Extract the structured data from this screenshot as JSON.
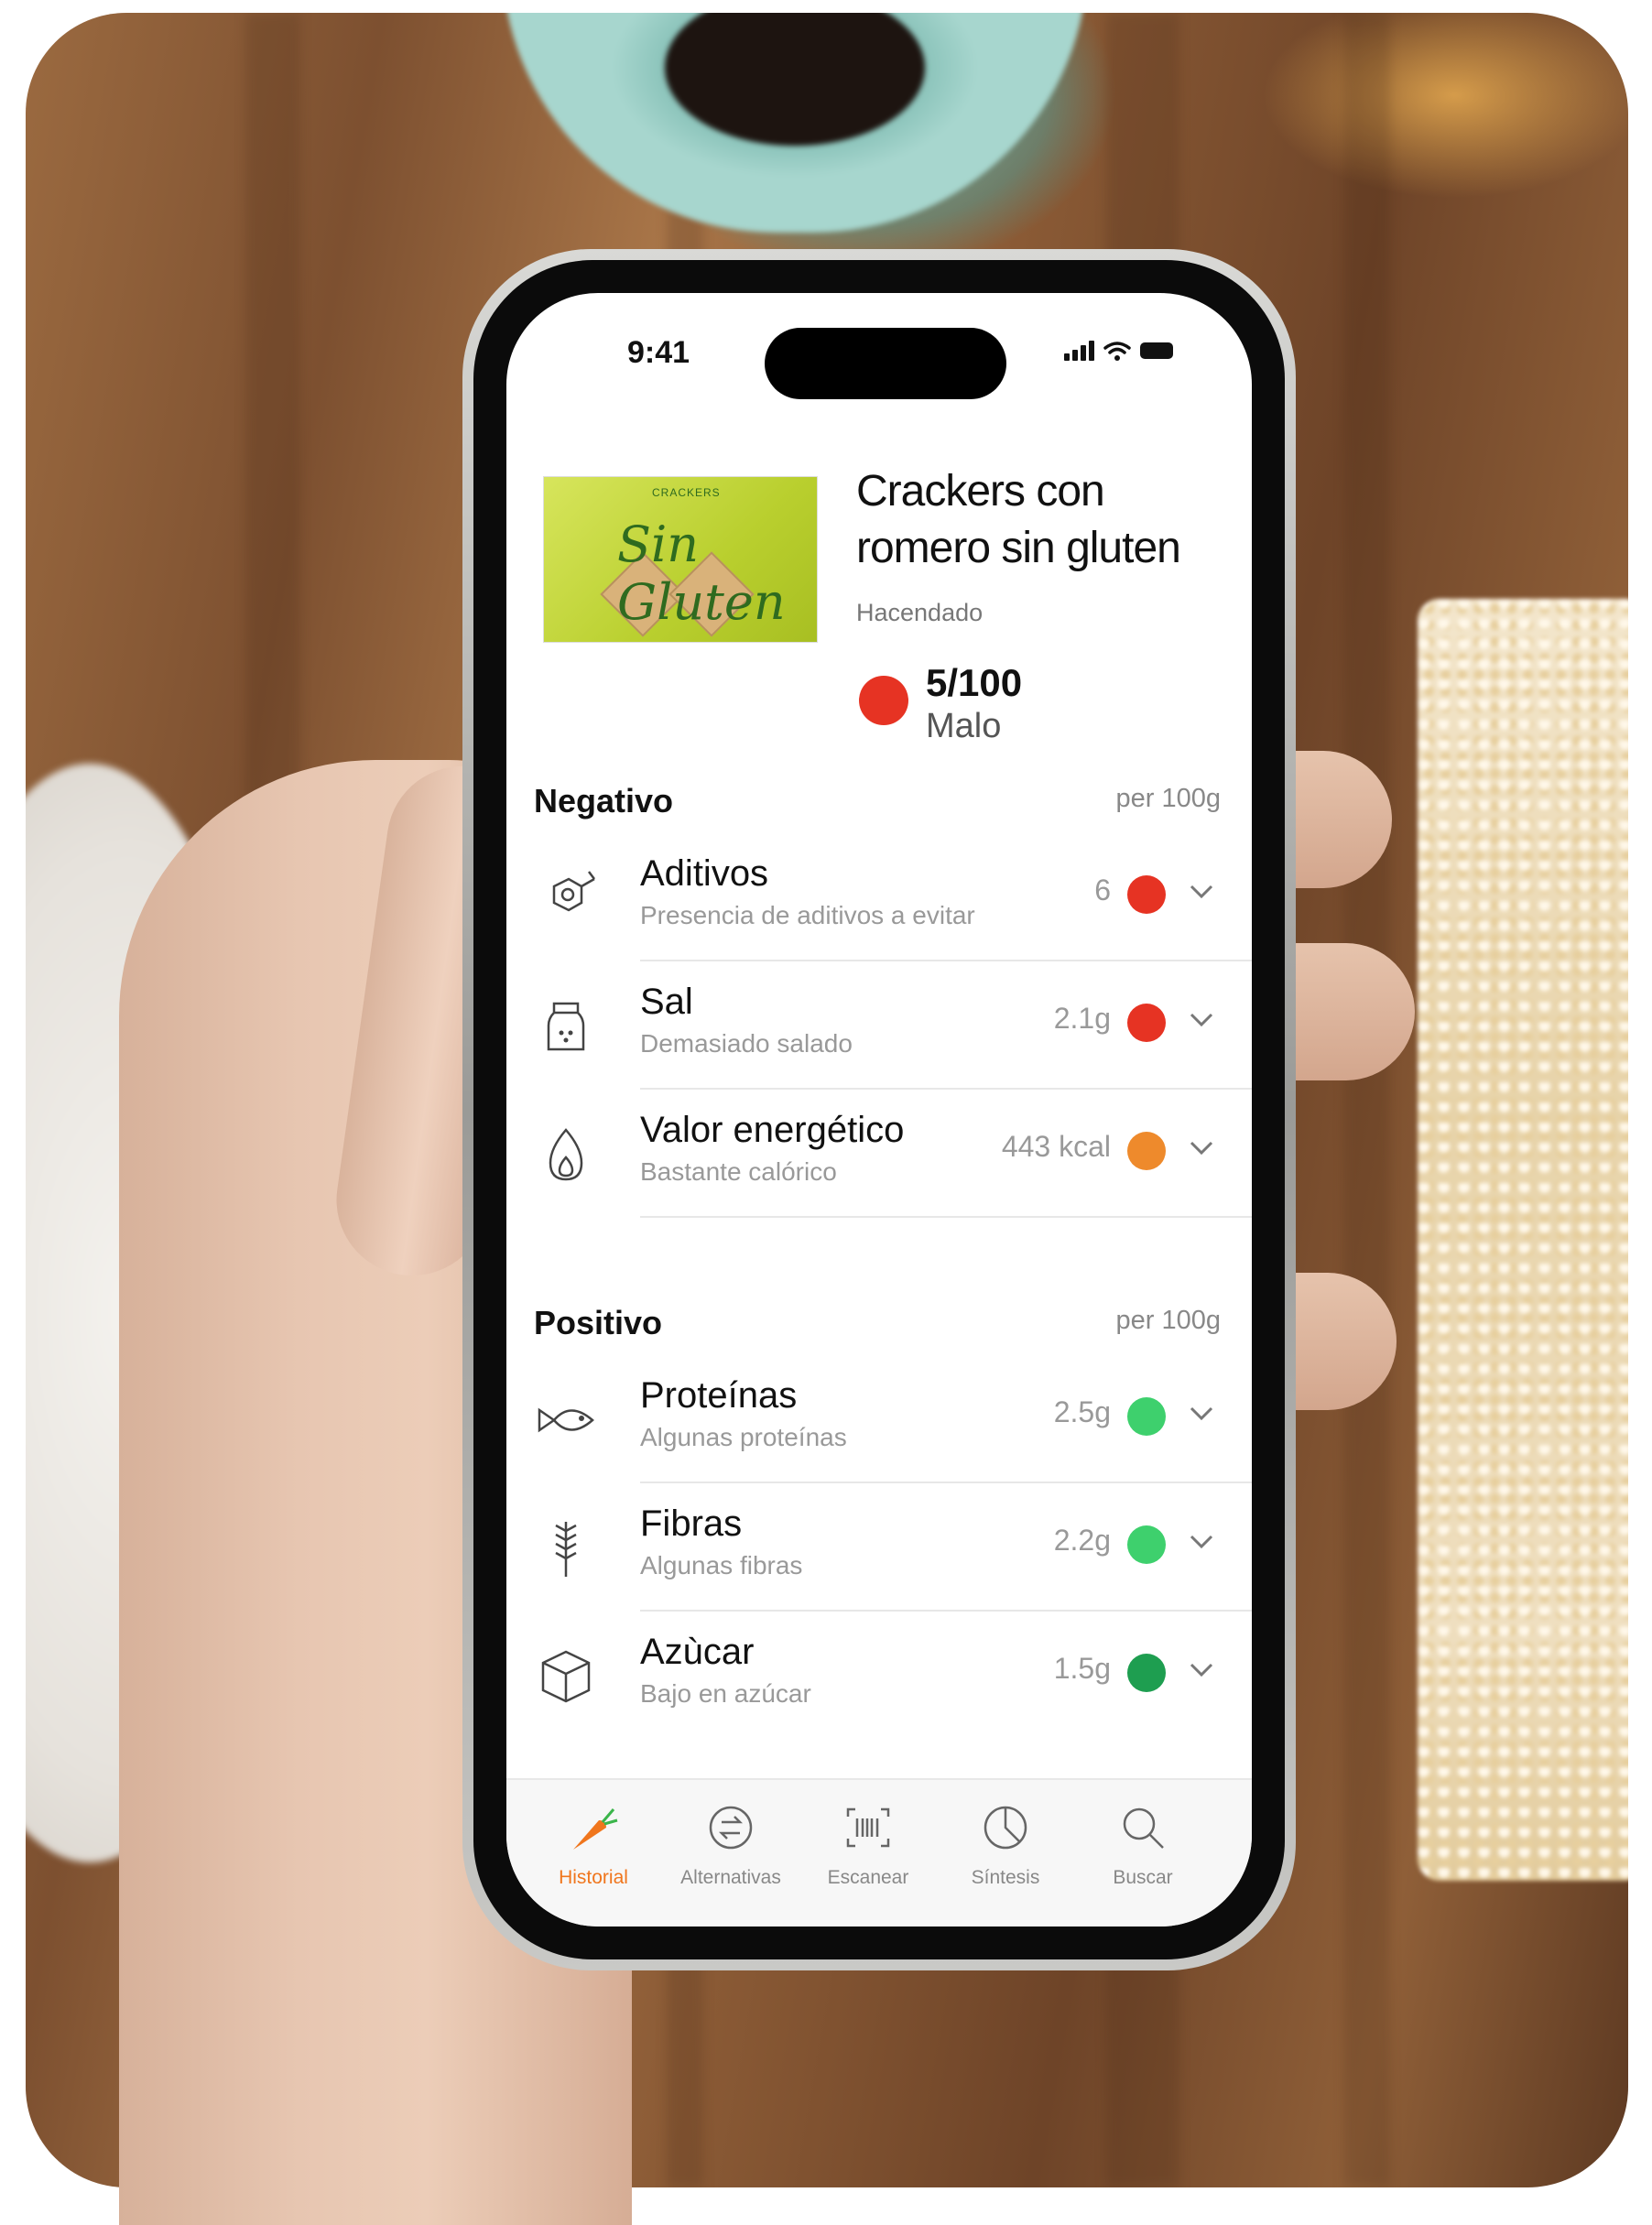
{
  "status": {
    "time": "9:41"
  },
  "product": {
    "name": "Crackers con romero sin gluten",
    "brand": "Hacendado",
    "score": "5/100",
    "rating": "Malo",
    "score_color": "#e63323",
    "package_text": "Sin Gluten",
    "package_tag": "CRACKERS"
  },
  "negative": {
    "title": "Negativo",
    "unit": "per 100g",
    "items": [
      {
        "name": "Aditivos",
        "desc": "Presencia de aditivos a evitar",
        "value": "6",
        "color": "#e63323",
        "icon": "molecule-icon"
      },
      {
        "name": "Sal",
        "desc": "Demasiado salado",
        "value": "2.1g",
        "color": "#e63323",
        "icon": "salt-shaker-icon"
      },
      {
        "name": "Valor energético",
        "desc": "Bastante calórico",
        "value": "443 kcal",
        "color": "#ee8a2c",
        "icon": "flame-icon"
      }
    ]
  },
  "positive": {
    "title": "Positivo",
    "unit": "per 100g",
    "items": [
      {
        "name": "Proteínas",
        "desc": "Algunas proteínas",
        "value": "2.5g",
        "color": "#3ed06d",
        "icon": "fish-icon"
      },
      {
        "name": "Fibras",
        "desc": "Algunas fibras",
        "value": "2.2g",
        "color": "#3ed06d",
        "icon": "wheat-icon"
      },
      {
        "name": "Azùcar",
        "desc": "Bajo en azúcar",
        "value": "1.5g",
        "color": "#1e9e50",
        "icon": "sugar-cube-icon"
      }
    ]
  },
  "tabbar": {
    "items": [
      {
        "label": "Historial",
        "icon": "carrot-icon",
        "active": true
      },
      {
        "label": "Alternativas",
        "icon": "swap-icon",
        "active": false
      },
      {
        "label": "Escanear",
        "icon": "barcode-icon",
        "active": false
      },
      {
        "label": "Síntesis",
        "icon": "pie-chart-icon",
        "active": false
      },
      {
        "label": "Buscar",
        "icon": "search-icon",
        "active": false
      }
    ],
    "active_color": "#f0761d"
  }
}
